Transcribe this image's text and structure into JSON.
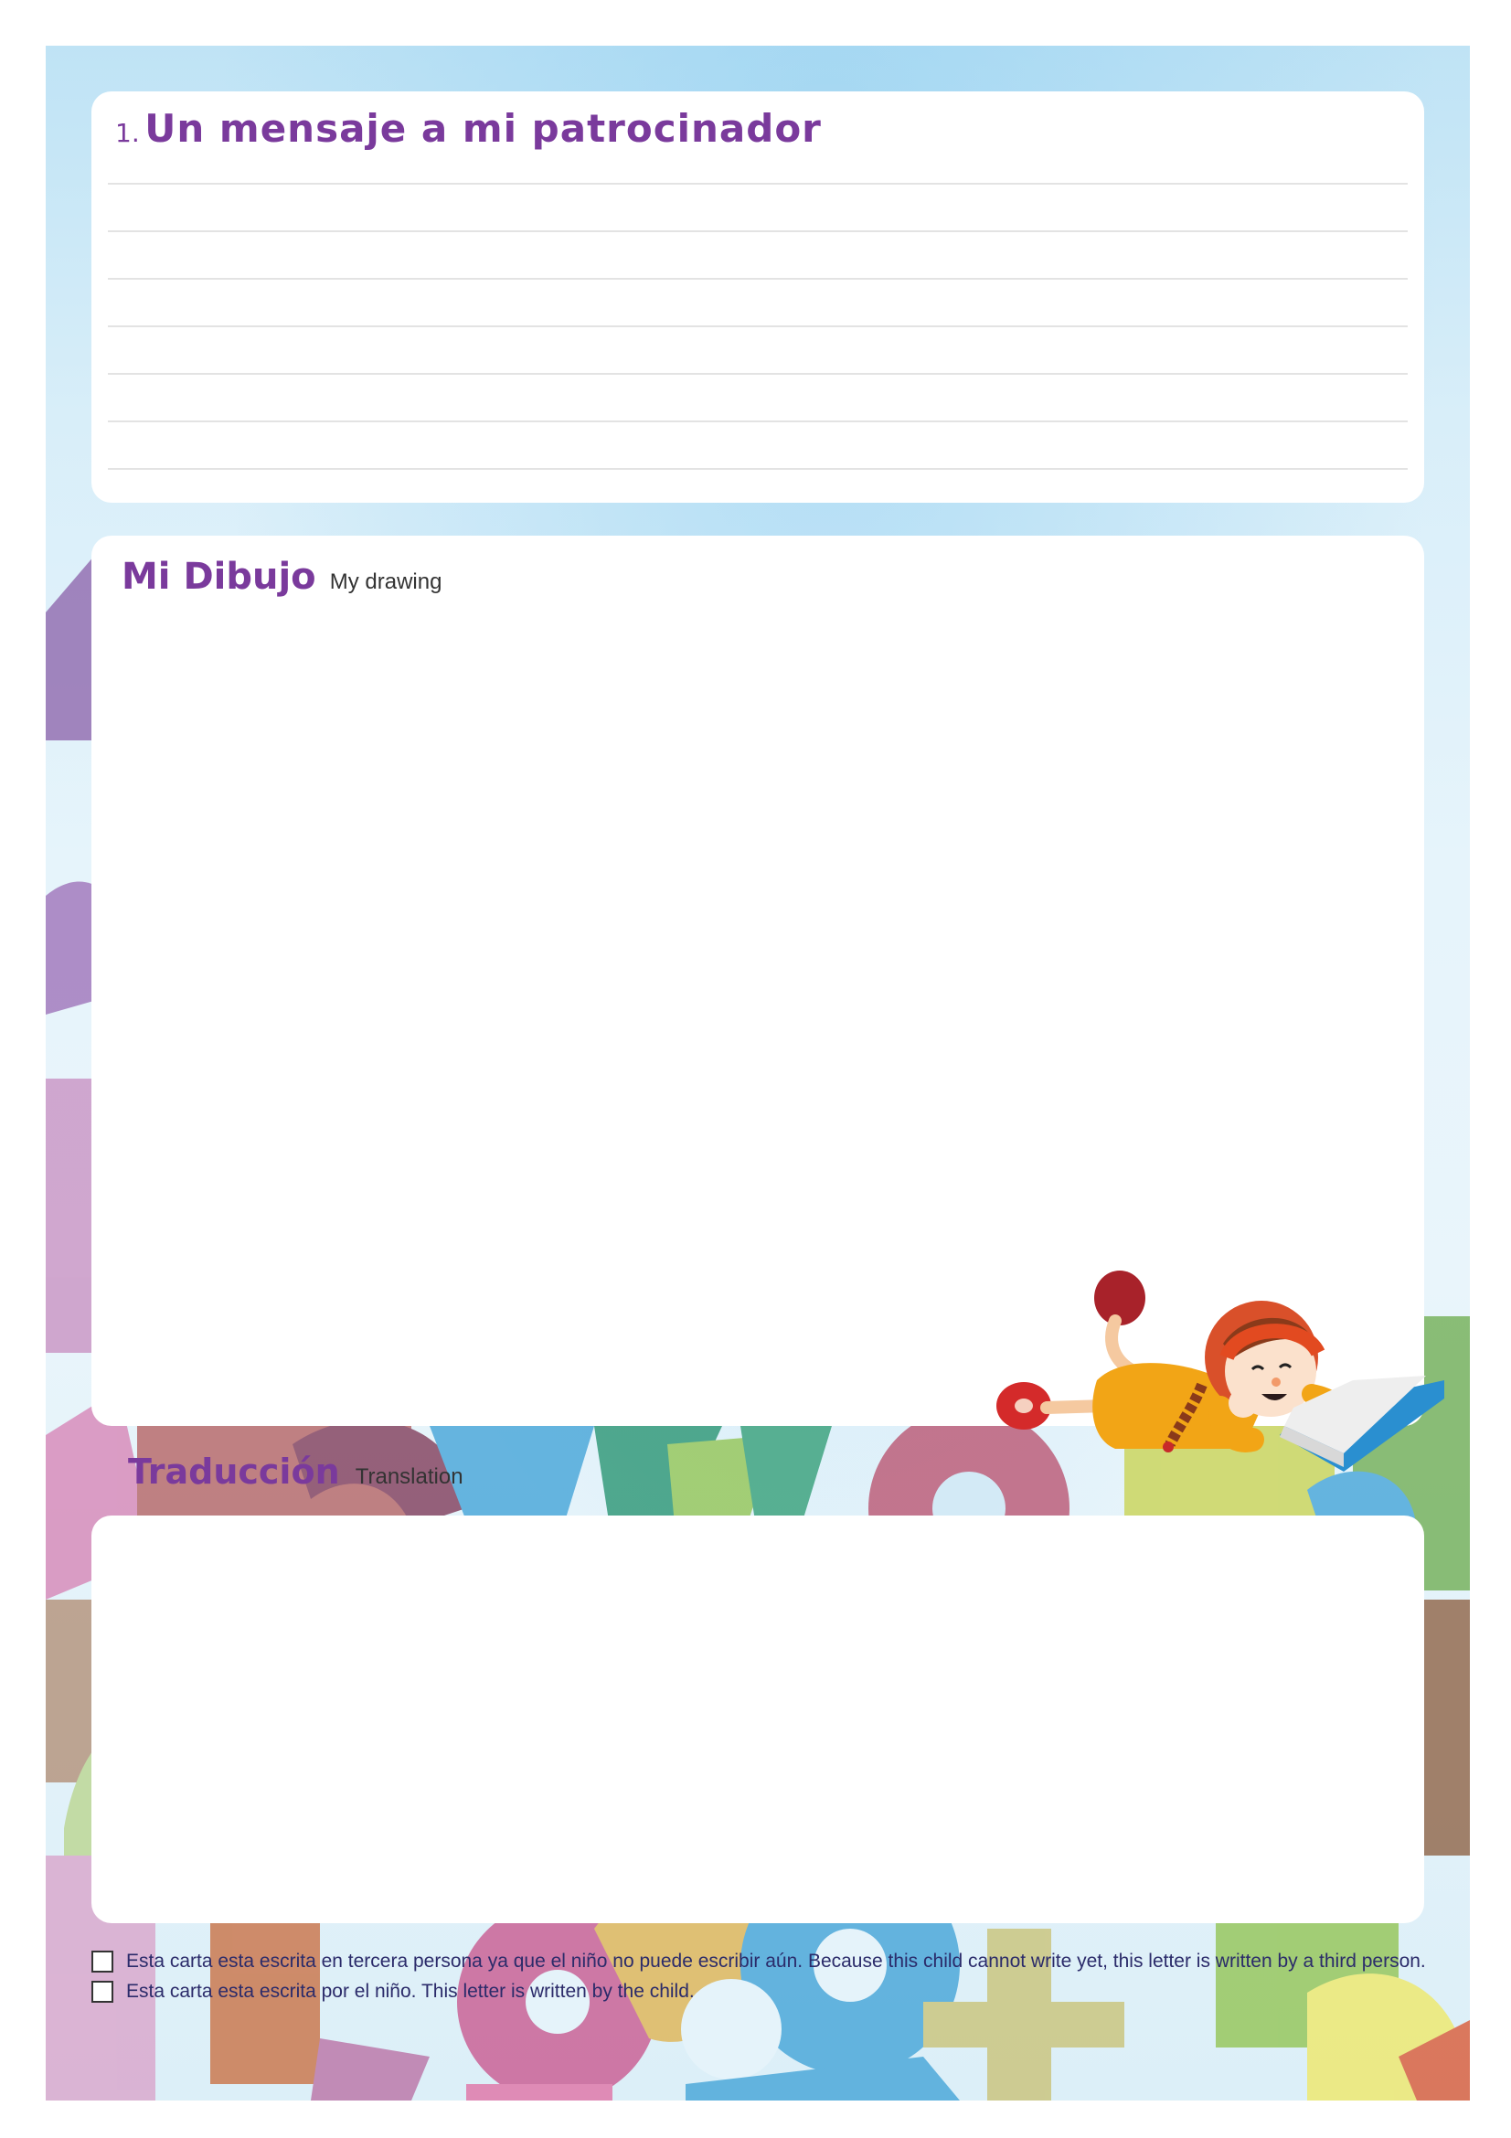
{
  "message_section": {
    "number": "1.",
    "title": "Un mensaje a mi patrocinador"
  },
  "drawing_section": {
    "title": "Mi Dibujo",
    "subtitle": "My drawing"
  },
  "translation_section": {
    "title": "Traducción",
    "subtitle": "Translation"
  },
  "checkboxes": [
    {
      "label": "Esta carta esta escrita en tercera persona ya que el niño no puede escribir aún. Because this child cannot write yet, this letter is written by a third person."
    },
    {
      "label": "Esta carta esta escrita por el niño. This letter is written by the child."
    }
  ],
  "colors": {
    "title_purple": "#7a3a9c",
    "background_blue": "#d8eef9"
  },
  "illustration": "girl-reading-book"
}
